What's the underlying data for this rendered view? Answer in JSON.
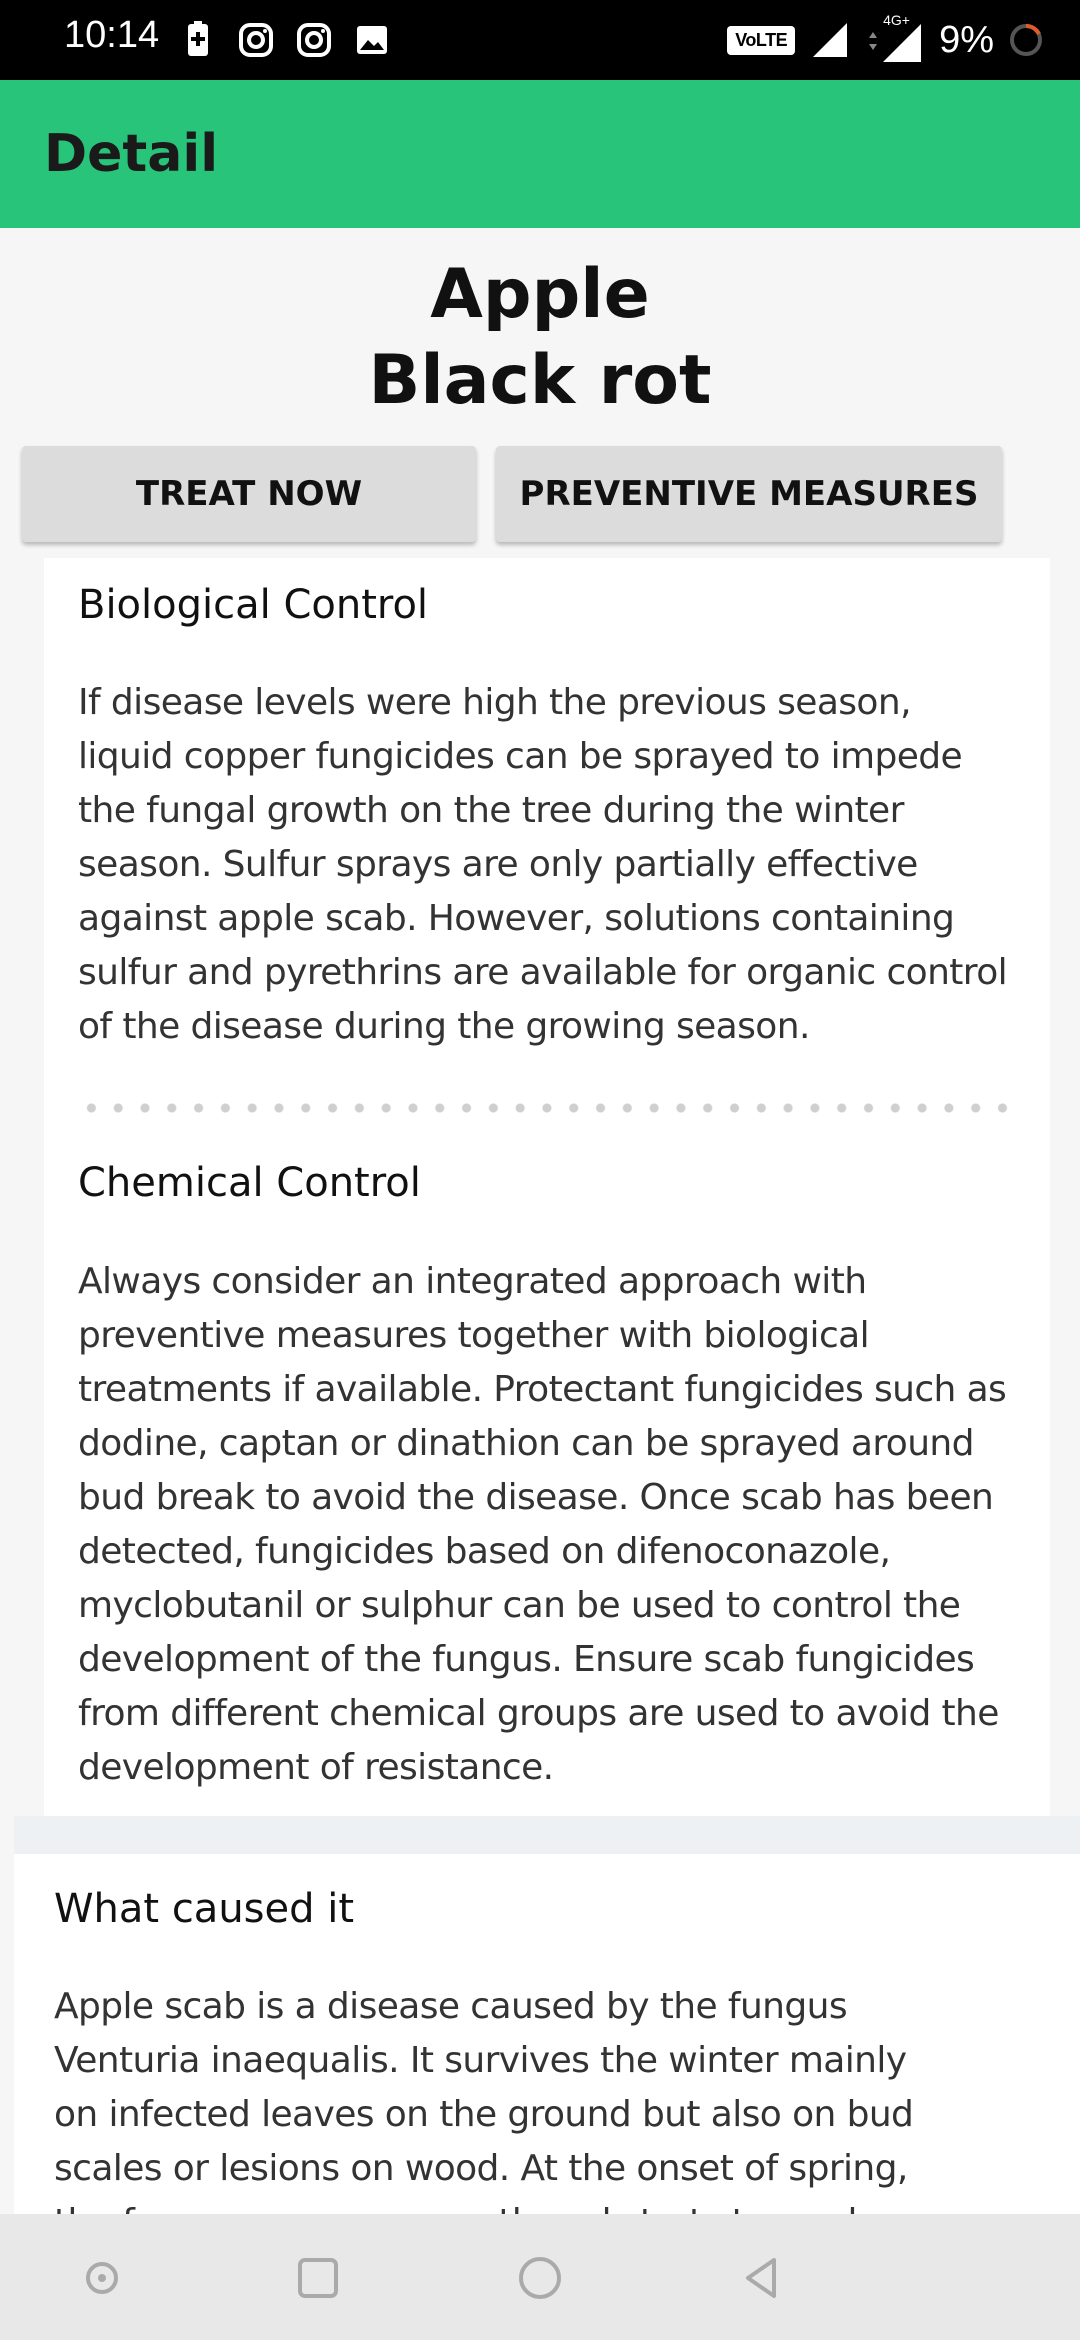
{
  "status_bar": {
    "time": "10:14",
    "network_badge": "VoLTE",
    "network_type": "4G+",
    "battery": "9%",
    "icons": [
      "battery-saver-icon",
      "instagram-icon",
      "instagram-icon",
      "image-icon",
      "signal-icon",
      "signal-icon",
      "loading-icon"
    ]
  },
  "app_bar": {
    "title": "Detail"
  },
  "header": {
    "plant": "Apple",
    "disease": "Black rot"
  },
  "buttons": {
    "treat_now": "TREAT NOW",
    "preventive": "PREVENTIVE MEASURES"
  },
  "treatment": {
    "biological_title": "Biological Control",
    "biological_lines": [
      "If disease levels were high the previous season,",
      "liquid copper fungicides can be sprayed to impede",
      "the fungal growth on the tree during the winter",
      "season. Sulfur sprays are only partially effective",
      "against apple scab. However, solutions containing",
      "sulfur and pyrethrins are available for organic control",
      "of the disease during the growing season."
    ],
    "chemical_title": "Chemical Control",
    "chemical_lines": [
      "Always consider an integrated approach with",
      "preventive measures together with biological",
      "treatments if available. Protectant fungicides such as",
      "dodine, captan or dinathion can be sprayed around",
      "bud break to avoid the disease. Once scab has been",
      "detected, fungicides based on difenoconazole,",
      "myclobutanil or sulphur can be used to control the",
      "development of the fungus. Ensure scab fungicides",
      "from different chemical groups are used to avoid the",
      "development of resistance."
    ]
  },
  "cause": {
    "title": "What caused it",
    "lines": [
      "Apple scab is a disease caused by the fungus",
      "Venturia inaequalis. It survives the winter mainly",
      "on infected leaves on the ground but also on bud",
      "scales or lesions on wood. At the onset of spring,",
      "the fungus resumes growth and starts to produce"
    ]
  },
  "colors": {
    "accent": "#28c47a",
    "button_bg": "#dcdcdc"
  }
}
